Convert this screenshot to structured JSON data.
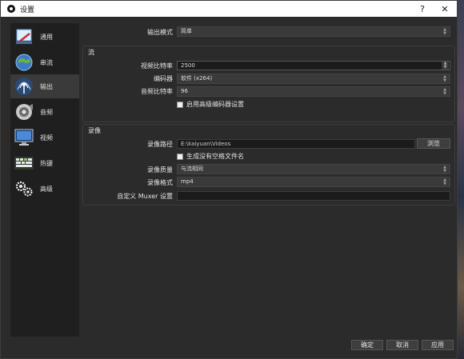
{
  "window": {
    "title": "设置",
    "help_glyph": "?",
    "close_glyph": "✕"
  },
  "sidebar": {
    "items": [
      {
        "label": "通用",
        "icon": "wrench-icon"
      },
      {
        "label": "串流",
        "icon": "globe-icon"
      },
      {
        "label": "输出",
        "icon": "broadcast-icon"
      },
      {
        "label": "音频",
        "icon": "speaker-icon"
      },
      {
        "label": "视频",
        "icon": "monitor-icon"
      },
      {
        "label": "热键",
        "icon": "keyboard-icon"
      },
      {
        "label": "高级",
        "icon": "gears-icon"
      }
    ],
    "active_index": 2
  },
  "output": {
    "mode_label": "输出模式",
    "mode_value": "简单"
  },
  "streaming": {
    "title": "流",
    "video_bitrate_label": "视频比特率",
    "video_bitrate_value": "2500",
    "encoder_label": "编码器",
    "encoder_value": "软件 (x264)",
    "audio_bitrate_label": "音频比特率",
    "audio_bitrate_value": "96",
    "advanced_checkbox_label": "启用高级编码器设置"
  },
  "recording": {
    "title": "录像",
    "path_label": "录像路径",
    "path_value": "E:\\kaiyuan\\Videos",
    "browse_label": "浏览",
    "no_space_checkbox_label": "生成没有空格文件名",
    "quality_label": "录像质量",
    "quality_value": "与流相同",
    "format_label": "录像格式",
    "format_value": "mp4",
    "muxer_label": "自定义 Muxer 设置",
    "muxer_value": ""
  },
  "footer": {
    "ok_label": "确定",
    "cancel_label": "取消",
    "apply_label": "应用"
  },
  "colors": {
    "window_bg": "#2b2b2b",
    "sidebar_bg": "#1f1f1f",
    "active_item_bg": "#3a3a3a"
  }
}
